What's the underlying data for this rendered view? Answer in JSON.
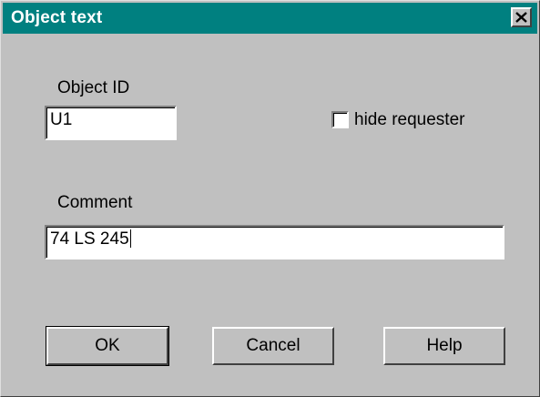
{
  "window": {
    "title": "Object text",
    "close_icon": "close-icon"
  },
  "form": {
    "object_id_label": "Object ID",
    "object_id_value": "U1",
    "hide_requester_label": "hide requester",
    "hide_requester_checked": false,
    "comment_label": "Comment",
    "comment_value": "74 LS 245"
  },
  "buttons": {
    "ok": "OK",
    "cancel": "Cancel",
    "help": "Help"
  },
  "colors": {
    "titlebar": "#008080",
    "dialog_face": "#c0c0c0"
  }
}
